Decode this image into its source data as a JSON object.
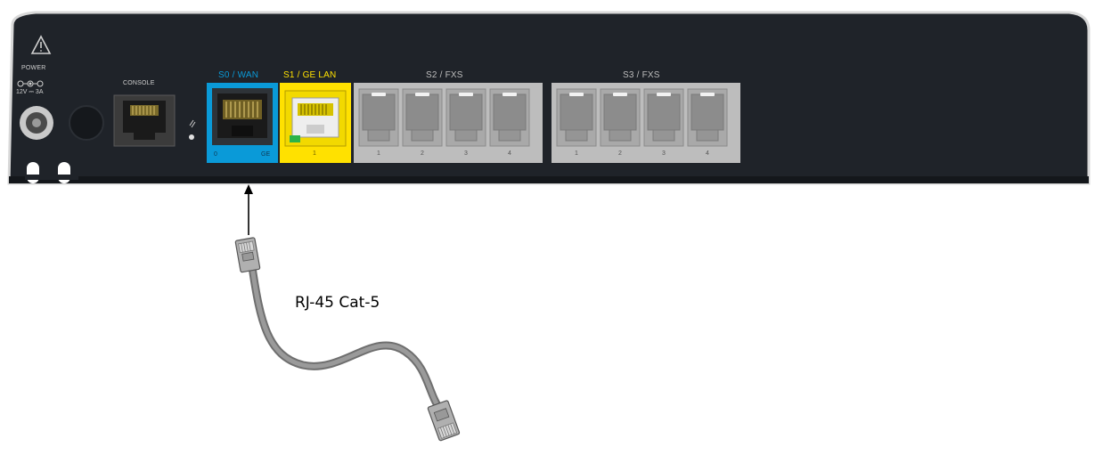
{
  "device": {
    "warning_icon": "warning-triangle-icon",
    "power": {
      "label": "POWER",
      "rating": "12V ⎓ 3A"
    },
    "console": {
      "label": "CONSOLE"
    },
    "s0_wan": {
      "label": "S0 / WAN",
      "color": "#0a9ad8",
      "left_text": "0",
      "right_text": "GE"
    },
    "s1_lan": {
      "label": "S1 / GE LAN",
      "color": "#ffe100",
      "port_number": "1"
    },
    "s2_fxs": {
      "label": "S2 / FXS",
      "ports": [
        "1",
        "2",
        "3",
        "4"
      ]
    },
    "s3_fxs": {
      "label": "S3 / FXS",
      "ports": [
        "1",
        "2",
        "3",
        "4"
      ]
    },
    "body_color": "#1f2329",
    "group_color": "#bdbdbd"
  },
  "cable": {
    "label": "RJ-45 Cat-5",
    "color": "#8c8c8c"
  }
}
